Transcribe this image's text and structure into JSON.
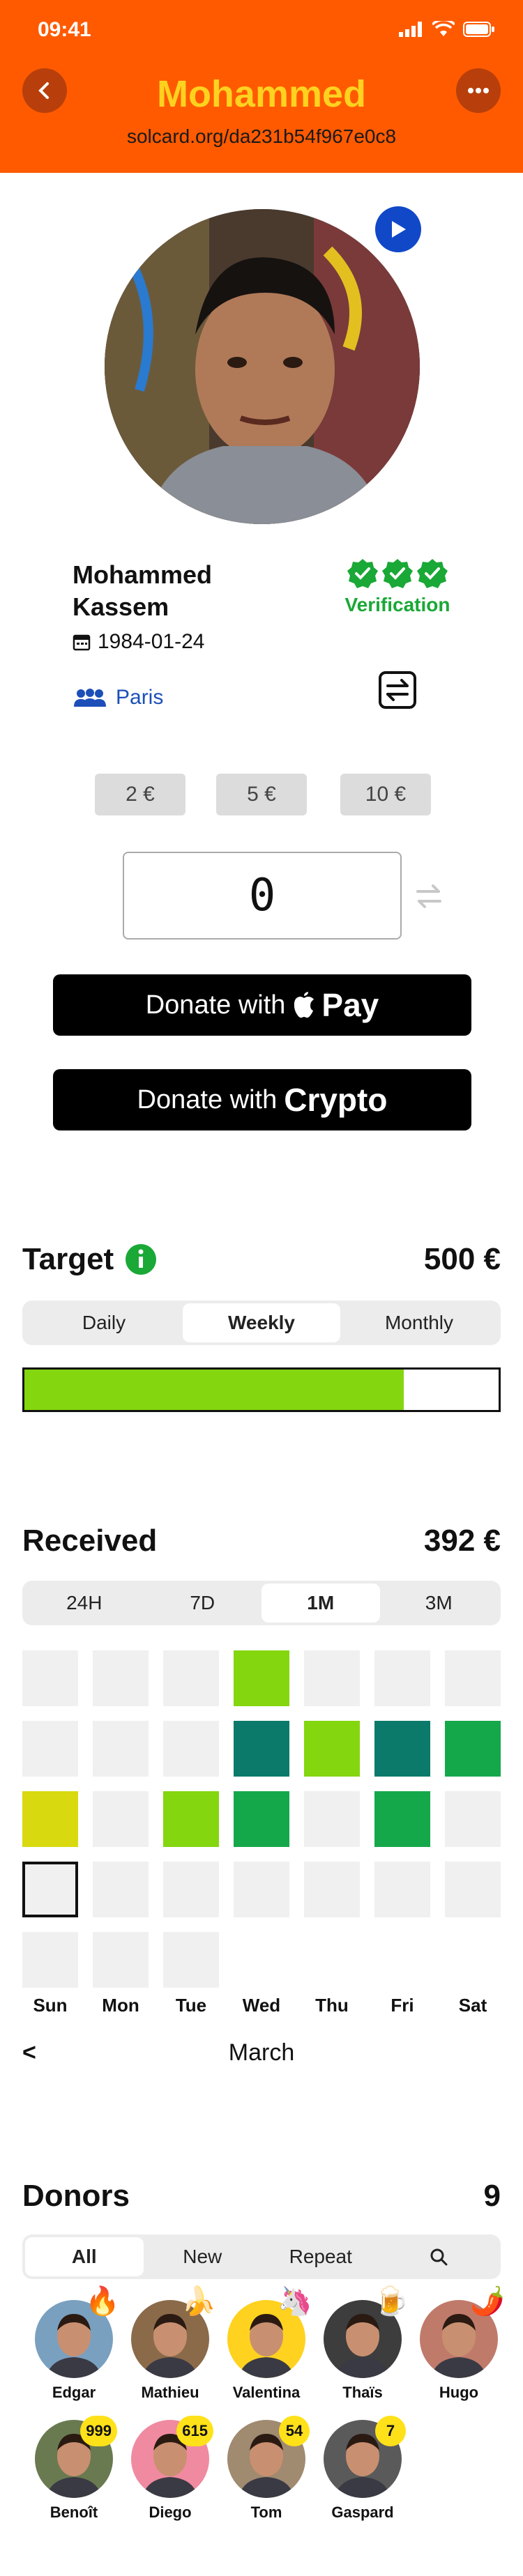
{
  "status_bar": {
    "time": "09:41"
  },
  "header": {
    "title": "Mohammed",
    "url": "solcard.org/da231b54f967e0c8",
    "bg_color": "#ff5a00",
    "title_color": "#ffd21f"
  },
  "profile": {
    "name": "Mohammed Kassem",
    "dob": "1984-01-24",
    "city": "Paris",
    "verification_label": "Verification"
  },
  "amounts": {
    "options": [
      "2 €",
      "5 €",
      "10 €"
    ],
    "current": "0"
  },
  "donate": {
    "apple_prefix": "Donate with",
    "apple_suffix": "Pay",
    "crypto_prefix": "Donate with",
    "crypto_suffix": "Crypto"
  },
  "target": {
    "title": "Target",
    "value": "500 €",
    "tabs": [
      "Daily",
      "Weekly",
      "Monthly"
    ],
    "active_tab": "Weekly",
    "progress": 0.8,
    "progress_color": "#84d60f"
  },
  "received": {
    "title": "Received",
    "value": "392 €",
    "tabs": [
      "24H",
      "7D",
      "1M",
      "3M"
    ],
    "active_tab": "1M",
    "weekdays": [
      "Sun",
      "Mon",
      "Tue",
      "Wed",
      "Thu",
      "Fri",
      "Sat"
    ],
    "month": "March",
    "prev_label": "<",
    "heatmap_rows": [
      [
        "empty",
        "empty",
        "empty",
        "light",
        "empty",
        "empty",
        "empty"
      ],
      [
        "empty",
        "empty",
        "empty",
        "dark",
        "light",
        "dark",
        "mid"
      ],
      [
        "yellow",
        "empty",
        "light",
        "mid",
        "empty",
        "mid",
        "empty"
      ],
      [
        "today",
        "empty",
        "empty",
        "empty",
        "empty",
        "empty",
        "empty"
      ],
      [
        "empty",
        "empty",
        "empty"
      ]
    ],
    "colors": {
      "empty": "#f0f0f0",
      "light": "#84d60f",
      "mid": "#14a84a",
      "dark": "#0b7a6a",
      "yellow": "#d9d90f"
    }
  },
  "donors": {
    "title": "Donors",
    "count": "9",
    "tabs": [
      "All",
      "New",
      "Repeat"
    ],
    "active_tab": "All",
    "list": [
      {
        "name": "Edgar",
        "badge": "",
        "emoji": "🔥",
        "color": "#7aa0c0"
      },
      {
        "name": "Mathieu",
        "badge": "",
        "emoji": "🍌",
        "color": "#8b6a4a"
      },
      {
        "name": "Valentina",
        "badge": "",
        "emoji": "🦄",
        "color": "#ffd21f"
      },
      {
        "name": "Thaïs",
        "badge": "",
        "emoji": "🍺",
        "color": "#3d3d3d"
      },
      {
        "name": "Hugo",
        "badge": "",
        "emoji": "🌶️",
        "color": "#c07a6a"
      },
      {
        "name": "Benoît",
        "badge": "999",
        "emoji": "",
        "color": "#6a7a50"
      },
      {
        "name": "Diego",
        "badge": "615",
        "emoji": "",
        "color": "#f08aa0"
      },
      {
        "name": "Tom",
        "badge": "54",
        "emoji": "",
        "color": "#a08a70"
      },
      {
        "name": "Gaspard",
        "badge": "7",
        "emoji": "",
        "color": "#5a5a5a"
      }
    ]
  }
}
